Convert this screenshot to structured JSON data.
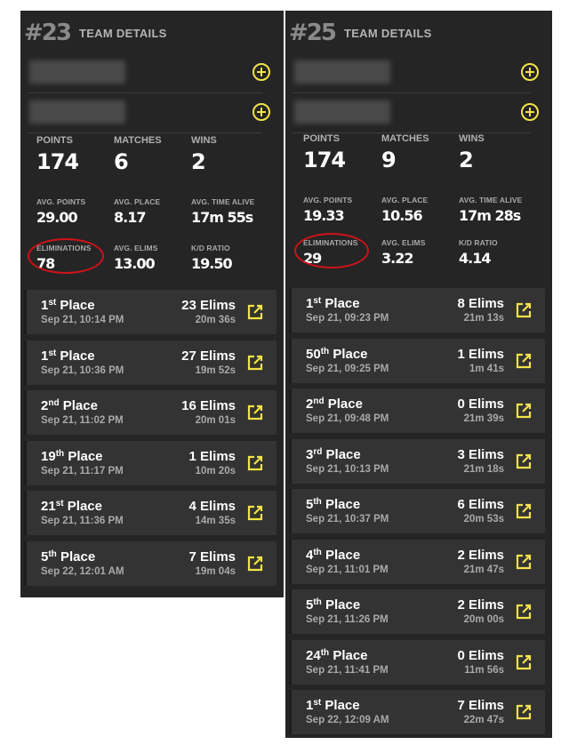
{
  "colors": {
    "accent": "#f2e34a",
    "panel": "#252525",
    "match_bg": "#333333",
    "circle": "#d0121a"
  },
  "teams": [
    {
      "rank": "#23",
      "title": "TEAM DETAILS",
      "players": [
        {
          "name": ""
        },
        {
          "name": ""
        }
      ],
      "stats": {
        "points_label": "POINTS",
        "points": "174",
        "matches_label": "MATCHES",
        "matches": "6",
        "wins_label": "WINS",
        "wins": "2",
        "avg_points_label": "AVG. POINTS",
        "avg_points": "29.00",
        "avg_place_label": "AVG. PLACE",
        "avg_place": "8.17",
        "avg_time_label": "AVG. TIME ALIVE",
        "avg_time": "17m 55s",
        "elims_label": "ELIMINATIONS",
        "elims": "78",
        "avg_elims_label": "AVG. ELIMS",
        "avg_elims": "13.00",
        "kd_label": "K/D RATIO",
        "kd": "19.50"
      },
      "matches": [
        {
          "place_num": "1",
          "place_suffix": "st",
          "place_word": "Place",
          "date": "Sep 21, 10:14 PM",
          "elims": "23 Elims",
          "time": "20m 36s"
        },
        {
          "place_num": "1",
          "place_suffix": "st",
          "place_word": "Place",
          "date": "Sep 21, 10:36 PM",
          "elims": "27 Elims",
          "time": "19m 52s"
        },
        {
          "place_num": "2",
          "place_suffix": "nd",
          "place_word": "Place",
          "date": "Sep 21, 11:02 PM",
          "elims": "16 Elims",
          "time": "20m 01s"
        },
        {
          "place_num": "19",
          "place_suffix": "th",
          "place_word": "Place",
          "date": "Sep 21, 11:17 PM",
          "elims": "1 Elims",
          "time": "10m 20s"
        },
        {
          "place_num": "21",
          "place_suffix": "st",
          "place_word": "Place",
          "date": "Sep 21, 11:36 PM",
          "elims": "4 Elims",
          "time": "14m 35s"
        },
        {
          "place_num": "5",
          "place_suffix": "th",
          "place_word": "Place",
          "date": "Sep 22, 12:01 AM",
          "elims": "7 Elims",
          "time": "19m 04s"
        }
      ]
    },
    {
      "rank": "#25",
      "title": "TEAM DETAILS",
      "players": [
        {
          "name": ""
        },
        {
          "name": ""
        }
      ],
      "stats": {
        "points_label": "POINTS",
        "points": "174",
        "matches_label": "MATCHES",
        "matches": "9",
        "wins_label": "WINS",
        "wins": "2",
        "avg_points_label": "AVG. POINTS",
        "avg_points": "19.33",
        "avg_place_label": "AVG. PLACE",
        "avg_place": "10.56",
        "avg_time_label": "AVG. TIME ALIVE",
        "avg_time": "17m 28s",
        "elims_label": "ELIMINATIONS",
        "elims": "29",
        "avg_elims_label": "AVG. ELIMS",
        "avg_elims": "3.22",
        "kd_label": "K/D RATIO",
        "kd": "4.14"
      },
      "matches": [
        {
          "place_num": "1",
          "place_suffix": "st",
          "place_word": "Place",
          "date": "Sep 21, 09:23 PM",
          "elims": "8 Elims",
          "time": "21m 13s"
        },
        {
          "place_num": "50",
          "place_suffix": "th",
          "place_word": "Place",
          "date": "Sep 21, 09:25 PM",
          "elims": "1 Elims",
          "time": "1m 41s"
        },
        {
          "place_num": "2",
          "place_suffix": "nd",
          "place_word": "Place",
          "date": "Sep 21, 09:48 PM",
          "elims": "0 Elims",
          "time": "21m 39s"
        },
        {
          "place_num": "3",
          "place_suffix": "rd",
          "place_word": "Place",
          "date": "Sep 21, 10:13 PM",
          "elims": "3 Elims",
          "time": "21m 18s"
        },
        {
          "place_num": "5",
          "place_suffix": "th",
          "place_word": "Place",
          "date": "Sep 21, 10:37 PM",
          "elims": "6 Elims",
          "time": "20m 53s"
        },
        {
          "place_num": "4",
          "place_suffix": "th",
          "place_word": "Place",
          "date": "Sep 21, 11:01 PM",
          "elims": "2 Elims",
          "time": "21m 47s"
        },
        {
          "place_num": "5",
          "place_suffix": "th",
          "place_word": "Place",
          "date": "Sep 21, 11:26 PM",
          "elims": "2 Elims",
          "time": "20m 00s"
        },
        {
          "place_num": "24",
          "place_suffix": "th",
          "place_word": "Place",
          "date": "Sep 21, 11:41 PM",
          "elims": "0 Elims",
          "time": "11m 56s"
        },
        {
          "place_num": "1",
          "place_suffix": "st",
          "place_word": "Place",
          "date": "Sep 22, 12:09 AM",
          "elims": "7 Elims",
          "time": "22m 47s"
        }
      ]
    }
  ]
}
